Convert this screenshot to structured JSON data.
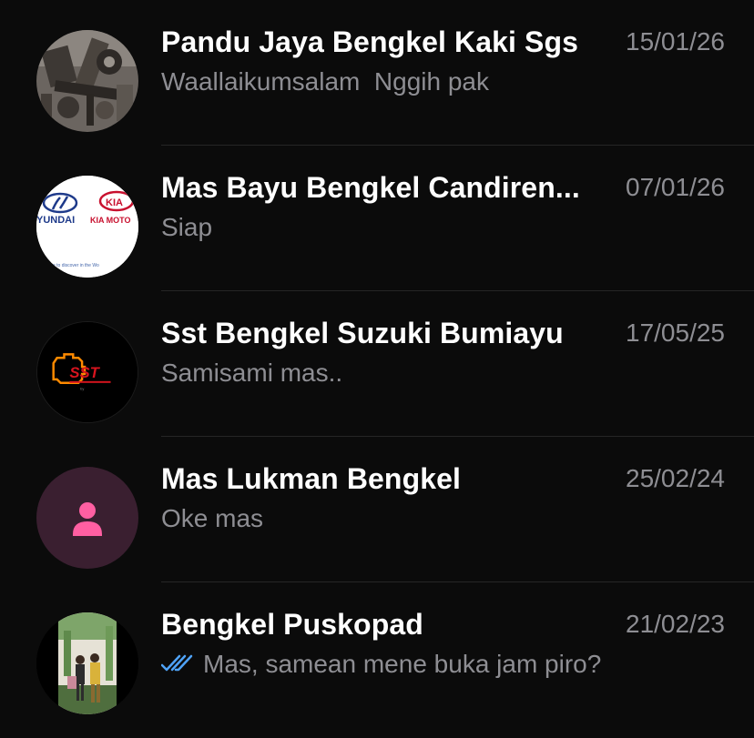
{
  "chats": [
    {
      "name": "Pandu Jaya Bengkel Kaki Sgs",
      "date": "15/01/26",
      "preview": "Waallaikumsalam  Nggih pak",
      "avatar": "photo-car-parts"
    },
    {
      "name": "Mas Bayu Bengkel Candiren...",
      "date": "07/01/26",
      "preview": "Siap",
      "avatar": "hyundai-kia-logo",
      "avatar_texts": {
        "brand_left": "YUNDAI",
        "brand_right": "KIA MOTO",
        "caption": "e to discover in the Wo"
      }
    },
    {
      "name": "Sst Bengkel Suzuki Bumiayu",
      "date": "17/05/25",
      "preview": "Samisami mas..",
      "avatar": "sst-logo",
      "avatar_texts": {
        "logo": "SST"
      }
    },
    {
      "name": "Mas Lukman Bengkel",
      "date": "25/02/24",
      "preview": "Oke mas",
      "avatar": "default-person"
    },
    {
      "name": "Bengkel Puskopad",
      "date": "21/02/23",
      "preview": "Mas, samean mene buka jam piro?",
      "avatar": "photo-people",
      "read_status": "read"
    }
  ],
  "colors": {
    "background": "#0b0b0b",
    "name": "#ffffff",
    "secondary": "#8e8e93",
    "divider": "#262626",
    "read_tick": "#4fa3f7",
    "default_avatar_bg": "#3a1f30",
    "default_avatar_fg": "#ff5fa2"
  }
}
